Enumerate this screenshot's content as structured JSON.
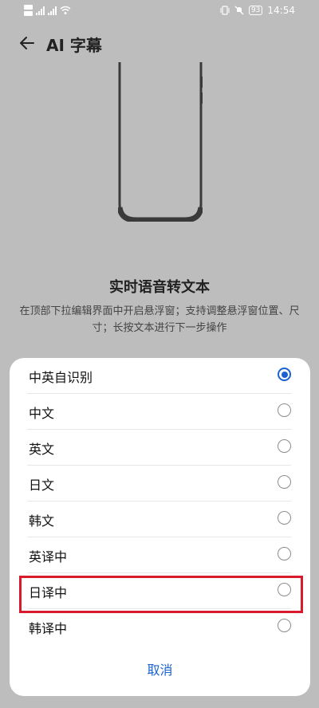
{
  "status_bar": {
    "time": "14:54",
    "battery": "93",
    "sim1": "HD 1",
    "sim2": "HD 2",
    "net1": "4G",
    "net2": "4G"
  },
  "header": {
    "title": "AI 字幕"
  },
  "feature": {
    "title": "实时语音转文本",
    "description": "在顶部下拉编辑界面中开启悬浮窗；支持调整悬浮窗位置、尺寸；长按文本进行下一步操作"
  },
  "options": [
    {
      "label": "中英自识别",
      "selected": true
    },
    {
      "label": "中文",
      "selected": false
    },
    {
      "label": "英文",
      "selected": false
    },
    {
      "label": "日文",
      "selected": false
    },
    {
      "label": "韩文",
      "selected": false
    },
    {
      "label": "英译中",
      "selected": false
    },
    {
      "label": "日译中",
      "selected": false
    },
    {
      "label": "韩译中",
      "selected": false
    }
  ],
  "cancel_label": "取消",
  "colors": {
    "accent": "#1a62d0",
    "highlight": "#d81b2c"
  }
}
